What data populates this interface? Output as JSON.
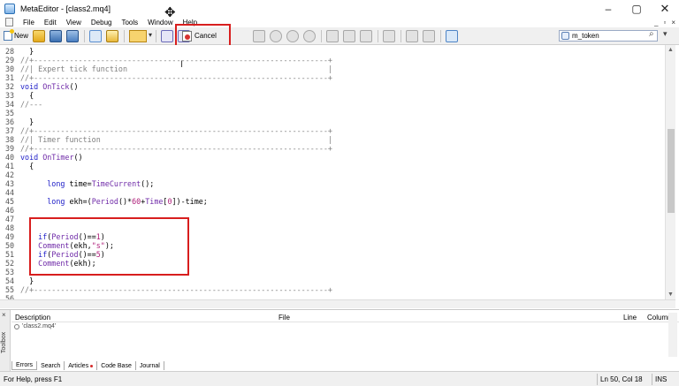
{
  "window": {
    "title": "MetaEditor - [class2.mq4]",
    "controls": {
      "minimize": "–",
      "maximize": "▢",
      "close": "✕"
    }
  },
  "menu": {
    "items": [
      "File",
      "Edit",
      "View",
      "Debug",
      "Tools",
      "Window",
      "Help"
    ],
    "doc_controls": [
      "_",
      "▫",
      "×"
    ]
  },
  "toolbar": {
    "new_label": "New",
    "cancel_label": "Cancel",
    "search_value": "m_token",
    "search_icon": "⌕",
    "dropdown_arrow": "▾"
  },
  "editor": {
    "lines": [
      {
        "n": "28",
        "text": "  }"
      },
      {
        "n": "29",
        "text": "//+------------------------------------------------------------------+"
      },
      {
        "n": "30",
        "text": "//| Expert tick function                                             |"
      },
      {
        "n": "31",
        "text": "//+------------------------------------------------------------------+"
      },
      {
        "n": "32",
        "text": "void OnTick()"
      },
      {
        "n": "33",
        "text": "  {"
      },
      {
        "n": "34",
        "text": "//---"
      },
      {
        "n": "35",
        "text": ""
      },
      {
        "n": "36",
        "text": "  }"
      },
      {
        "n": "37",
        "text": "//+------------------------------------------------------------------+"
      },
      {
        "n": "38",
        "text": "//| Timer function                                                   |"
      },
      {
        "n": "39",
        "text": "//+------------------------------------------------------------------+"
      },
      {
        "n": "40",
        "text": "void OnTimer()"
      },
      {
        "n": "41",
        "text": "  {"
      },
      {
        "n": "42",
        "text": ""
      },
      {
        "n": "43",
        "text": "      long time=TimeCurrent();"
      },
      {
        "n": "44",
        "text": ""
      },
      {
        "n": "45",
        "text": "      long ekh=(Period()*60+Time[0])-time;"
      },
      {
        "n": "46",
        "text": ""
      },
      {
        "n": "47",
        "text": ""
      },
      {
        "n": "48",
        "text": ""
      },
      {
        "n": "49",
        "text": "    if(Period()==1)"
      },
      {
        "n": "50",
        "text": "    Comment(ekh,\"s\");"
      },
      {
        "n": "51",
        "text": "    if(Period()==5)"
      },
      {
        "n": "52",
        "text": "    Comment(ekh);"
      },
      {
        "n": "53",
        "text": ""
      },
      {
        "n": "54",
        "text": "  }"
      },
      {
        "n": "55",
        "text": "//+------------------------------------------------------------------+"
      },
      {
        "n": "56",
        "text": ""
      }
    ]
  },
  "toolbox": {
    "columns": {
      "description": "Description",
      "file": "File",
      "line": "Line",
      "column": "Column"
    },
    "rows": [
      {
        "description": "'class2.mq4'"
      }
    ],
    "side_label": "Toolbox",
    "close_glyph": "×",
    "tabs": [
      {
        "label": "Errors",
        "active": true
      },
      {
        "label": "Search",
        "active": false
      },
      {
        "label": "Articles",
        "active": false
      },
      {
        "label": "Code Base",
        "active": false
      },
      {
        "label": "Journal",
        "active": false
      }
    ]
  },
  "statusbar": {
    "help": "For Help, press F1",
    "position": "Ln 50, Col 18",
    "mode": "INS"
  },
  "colors": {
    "highlight": "#d81e1e",
    "keyword": "#1d1dc7",
    "function": "#6f2aa8",
    "comment": "#808080",
    "string": "#b0207b"
  }
}
